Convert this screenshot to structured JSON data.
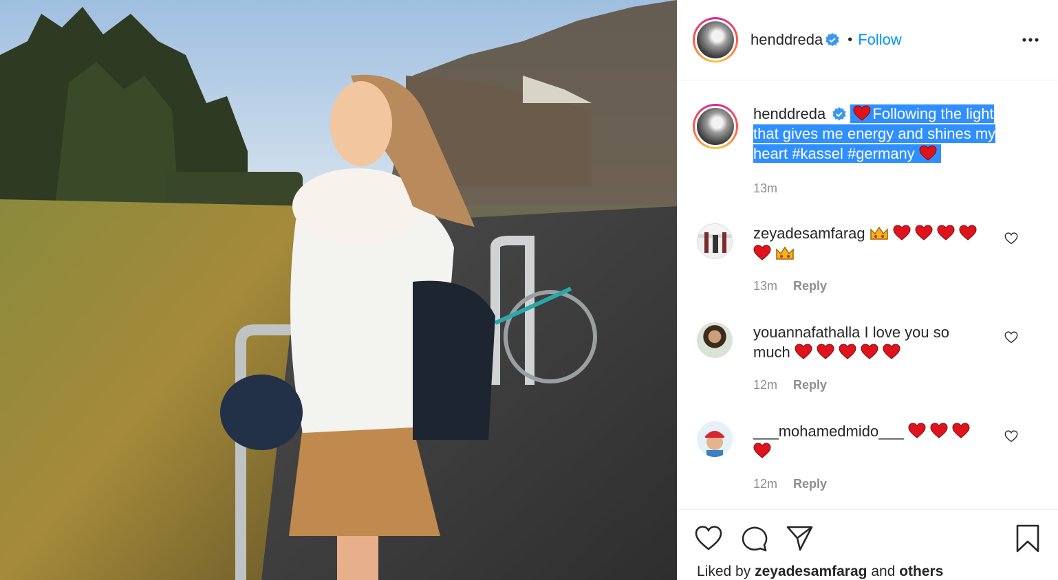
{
  "post": {
    "author": "henddreda",
    "follow_label": "Follow",
    "caption": {
      "author": "henddreda",
      "text": "Following the light that gives me energy and shines my heart #kassel #germany",
      "time": "13m"
    },
    "comments": [
      {
        "user": "zeyadesamfarag",
        "text": "",
        "emojis": [
          "crown-icon",
          "heart-icon",
          "heart-icon",
          "heart-icon",
          "heart-icon",
          "heart-icon",
          "crown-icon"
        ],
        "time": "13m",
        "reply_label": "Reply"
      },
      {
        "user": "youannafathalla",
        "text": "I love you so much",
        "emojis": [
          "heart-icon",
          "heart-icon",
          "heart-icon",
          "heart-icon",
          "heart-icon"
        ],
        "time": "12m",
        "reply_label": "Reply"
      },
      {
        "user": "___mohamedmido___",
        "text": "",
        "emojis": [
          "heart-icon",
          "heart-icon",
          "heart-icon",
          "heart-icon"
        ],
        "time": "12m",
        "reply_label": "Reply"
      }
    ],
    "liked_by": {
      "prefix": "Liked by",
      "user": "zeyadesamfarag",
      "conj": "and",
      "others": "others"
    }
  },
  "colors": {
    "link": "#0095f6",
    "muted": "#8e8e8e",
    "selection": "#2f8fff",
    "heart": "#e0131c"
  },
  "icons": [
    "verified-icon",
    "more-icon",
    "like-icon",
    "comment-icon",
    "share-icon",
    "save-icon"
  ]
}
